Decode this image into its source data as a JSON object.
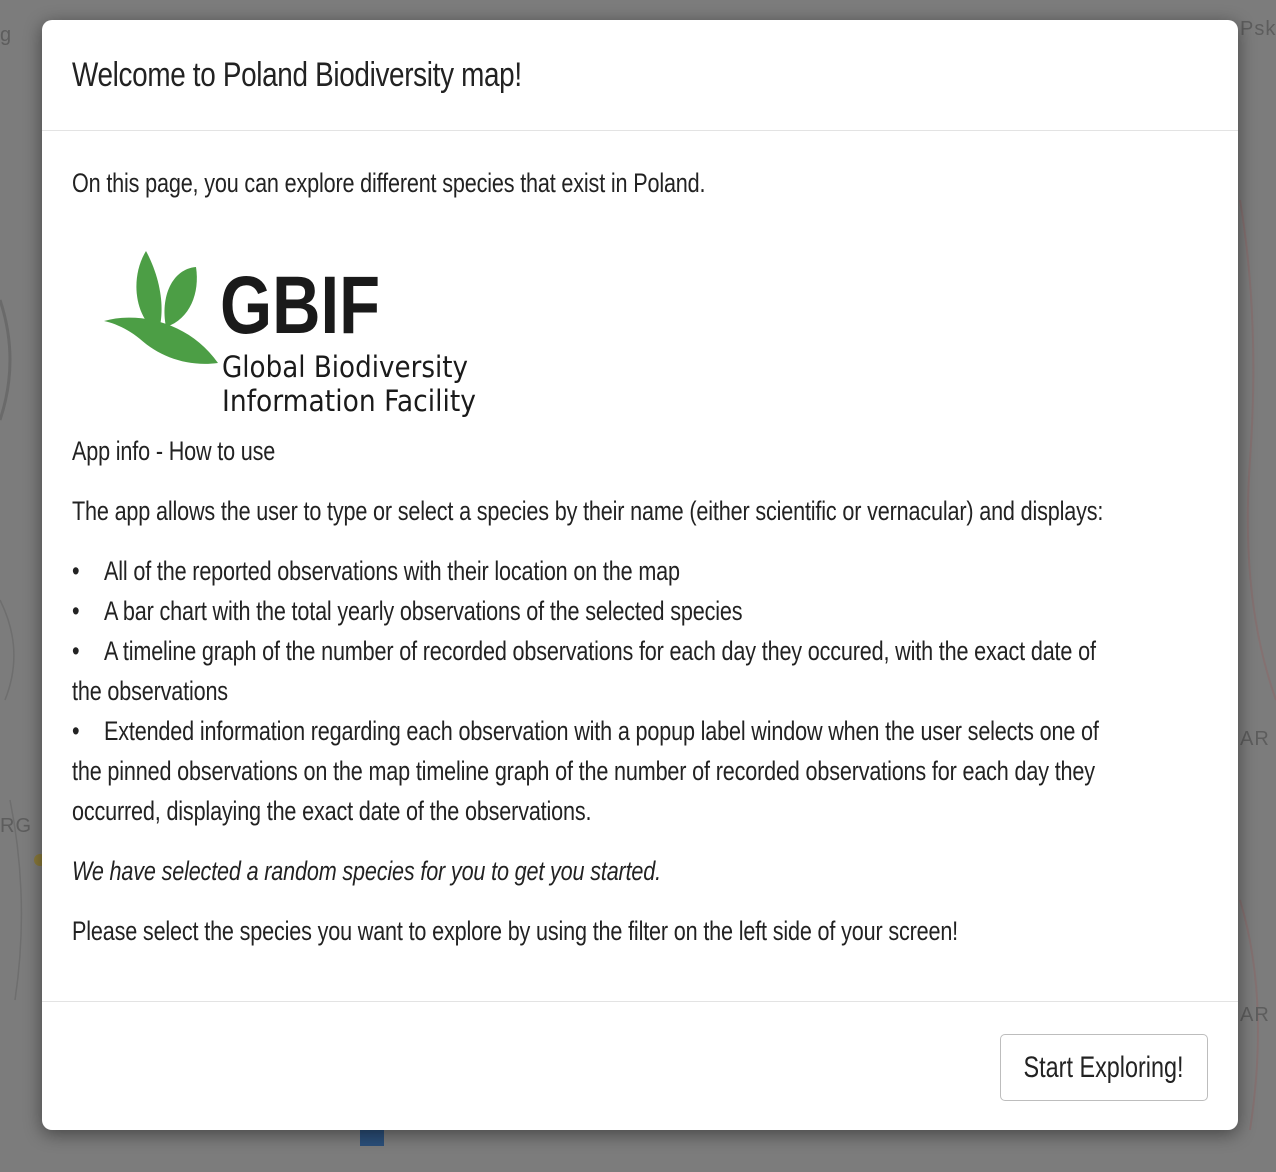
{
  "background_map": {
    "labels": [
      "g",
      "Psk",
      "RG",
      "AR",
      "AR"
    ]
  },
  "modal": {
    "title": "Welcome to Poland Biodiversity map!",
    "intro": "On this page, you can explore different species that exist in Poland.",
    "logo": {
      "wordmark": "GBIF",
      "line1": "Global Biodiversity",
      "line2": "Information Facility",
      "colors": {
        "leaf": "#4c9e45",
        "text": "#1a1a1a"
      }
    },
    "app_info_heading": "App info - How to use",
    "app_description": "The app allows the user to type or select a species by their name (either scientific or vernacular) and displays:",
    "features": [
      [
        "All of the reported observations with their location on the map"
      ],
      [
        "A bar chart with the total yearly observations of the selected species"
      ],
      [
        "A timeline graph of the number of recorded observations for each day they occured, with the exact date of",
        "the observations"
      ],
      [
        "Extended information regarding each observation with a popup label window when the user selects one of",
        "the pinned observations on the map timeline graph of the number of recorded observations for each day they",
        "occurred, displaying the exact date of the observations."
      ]
    ],
    "random_note": "We have selected a random species for you to get you started.",
    "instruction": "Please select the species you want to explore by using the filter on the left side of your screen!",
    "start_button": "Start Exploring!"
  }
}
